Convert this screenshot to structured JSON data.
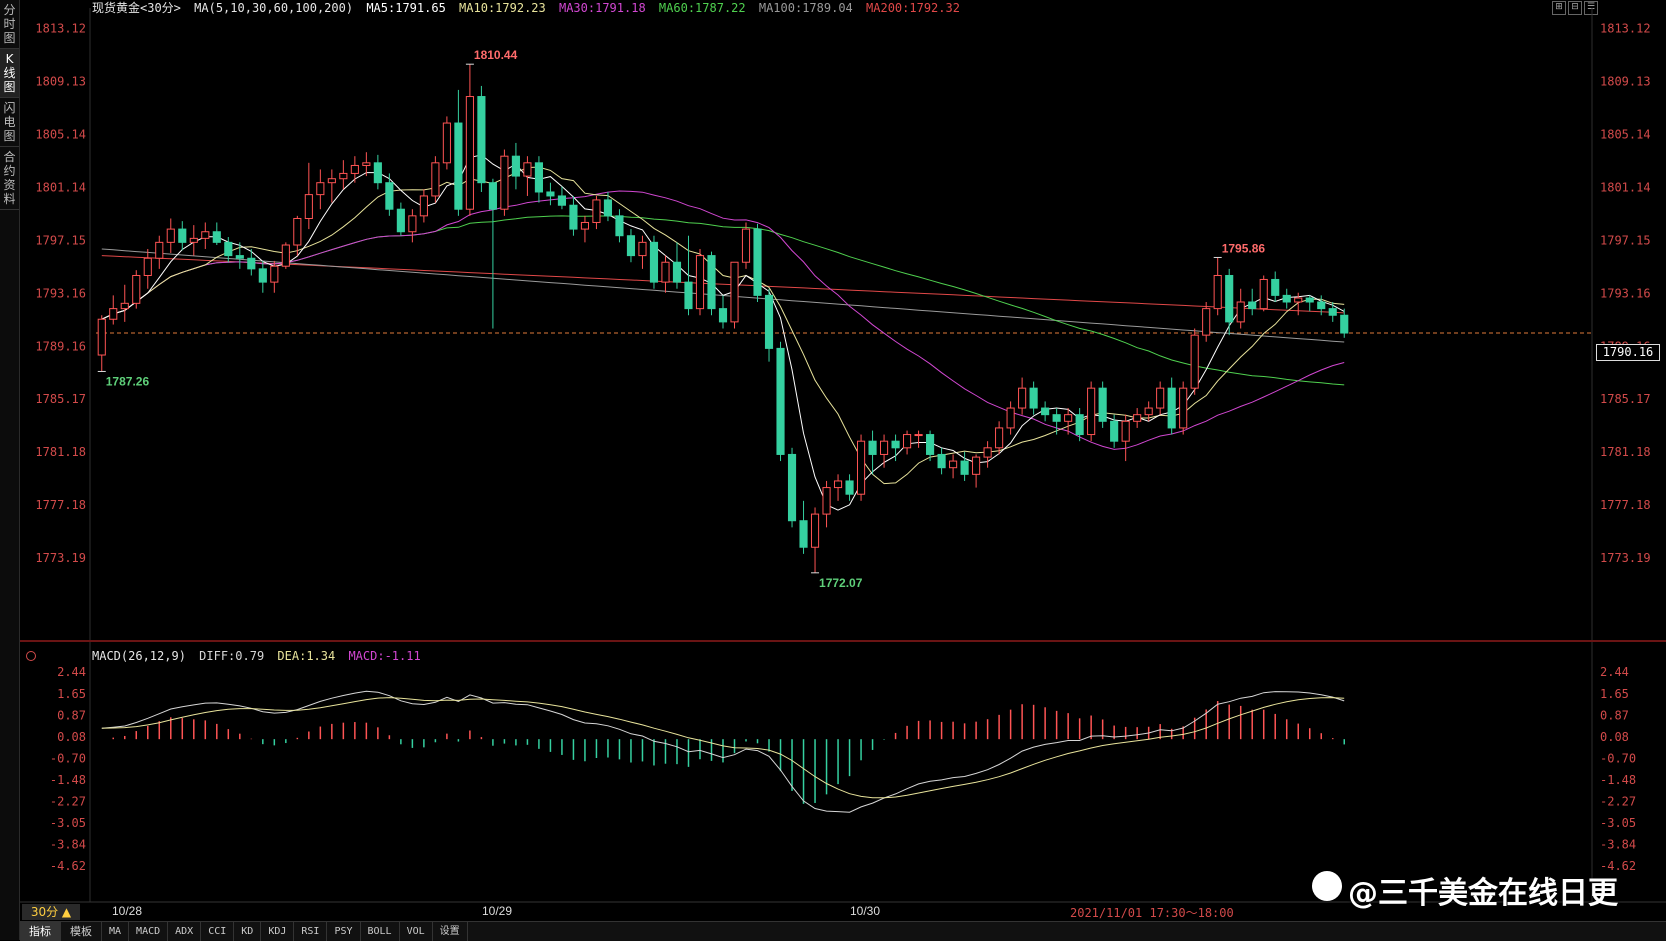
{
  "sidebar": [
    {
      "label": "分时图",
      "active": false
    },
    {
      "label": "K线图",
      "active": true
    },
    {
      "label": "闪电图",
      "active": false
    },
    {
      "label": "合约资料",
      "active": false
    }
  ],
  "header": {
    "symbol": "现货黄金<30分>",
    "ma_params": "MA(5,10,30,60,100,200)",
    "ma5": "MA5:1791.65",
    "ma10": "MA10:1792.23",
    "ma30": "MA30:1791.18",
    "ma60": "MA60:1787.22",
    "ma100": "MA100:1789.04",
    "ma200": "MA200:1792.32"
  },
  "window_buttons": [
    "⊞",
    "⊟",
    "☰"
  ],
  "macd_header": {
    "params": "MACD(26,12,9)",
    "diff": "DIFF:0.79",
    "dea": "DEA:1.34",
    "macd": "MACD:-1.11"
  },
  "price_ticks": [
    "1813.12",
    "1809.13",
    "1805.14",
    "1801.14",
    "1797.15",
    "1793.16",
    "1789.16",
    "1785.17",
    "1781.18",
    "1777.18",
    "1773.19"
  ],
  "right_price_ticks": [
    "1813.12",
    "1809.13",
    "1805.14",
    "1801.14",
    "1797.15",
    "1793.16",
    "1789.16",
    "1785.17",
    "1781.18",
    "1777.18",
    "1773.19"
  ],
  "macd_ticks": [
    "2.44",
    "1.65",
    "0.87",
    "0.08",
    "-0.70",
    "-1.48",
    "-2.27",
    "-3.05",
    "-3.84",
    "-4.62"
  ],
  "current_price": "1790.16",
  "annotations": {
    "high": "1810.44",
    "low": "1772.07",
    "start_low": "1787.26",
    "local_high": "1795.86"
  },
  "dates": [
    "10/28",
    "10/29",
    "10/30"
  ],
  "cursor_time": "2021/11/01  17:30～18:00",
  "period": "30分 ▲",
  "bottom_tabs": [
    "指标",
    "模板",
    "MA",
    "MACD",
    "ADX",
    "CCI",
    "KD",
    "KDJ",
    "RSI",
    "PSY",
    "BOLL",
    "VOL",
    "设置"
  ],
  "watermark": "@三千美金在线日更",
  "colors": {
    "up": "#ff5454",
    "down": "#35d0a0",
    "ma5": "#ffffff",
    "ma10": "#e8e39b",
    "ma30": "#d147d1",
    "ma60": "#4fd04f",
    "ma100": "#9a9a9a",
    "ma200": "#e04848",
    "diff_macd": "#d6d6d6",
    "dea": "#e8e39b",
    "axis": "#d24a4a"
  },
  "chart_data": {
    "type": "candlestick",
    "interval": "30min",
    "price_ylim": [
      1771.0,
      1814.0
    ],
    "macd_ylim": [
      -5.2,
      2.7
    ],
    "candles": [
      [
        1788.5,
        1791.5,
        1787.26,
        1791.2
      ],
      [
        1791.2,
        1793.0,
        1790.8,
        1792.0
      ],
      [
        1792.0,
        1793.8,
        1791.0,
        1792.4
      ],
      [
        1792.4,
        1794.9,
        1792.0,
        1794.5
      ],
      [
        1794.5,
        1796.5,
        1793.5,
        1795.8
      ],
      [
        1795.8,
        1797.5,
        1795.0,
        1797.0
      ],
      [
        1797.0,
        1798.8,
        1796.2,
        1798.0
      ],
      [
        1798.0,
        1798.6,
        1796.4,
        1797.0
      ],
      [
        1797.0,
        1798.3,
        1796.0,
        1797.3
      ],
      [
        1797.3,
        1798.5,
        1796.5,
        1797.8
      ],
      [
        1797.8,
        1798.5,
        1796.8,
        1797.0
      ],
      [
        1797.0,
        1797.4,
        1795.5,
        1796.0
      ],
      [
        1796.0,
        1797.0,
        1795.0,
        1795.8
      ],
      [
        1795.8,
        1796.5,
        1794.5,
        1795.0
      ],
      [
        1795.0,
        1795.6,
        1793.2,
        1794.0
      ],
      [
        1794.0,
        1795.6,
        1793.2,
        1795.2
      ],
      [
        1795.2,
        1797.0,
        1795.0,
        1796.8
      ],
      [
        1796.8,
        1799.0,
        1796.0,
        1798.8
      ],
      [
        1798.8,
        1803.0,
        1798.0,
        1800.6
      ],
      [
        1800.6,
        1802.5,
        1799.5,
        1801.5
      ],
      [
        1801.5,
        1802.5,
        1800.0,
        1801.8
      ],
      [
        1801.8,
        1803.2,
        1801.0,
        1802.2
      ],
      [
        1802.2,
        1803.5,
        1801.5,
        1802.8
      ],
      [
        1802.8,
        1803.8,
        1802.0,
        1803.0
      ],
      [
        1803.0,
        1803.6,
        1801.0,
        1801.5
      ],
      [
        1801.5,
        1802.2,
        1799.0,
        1799.5
      ],
      [
        1799.5,
        1800.0,
        1797.5,
        1797.8
      ],
      [
        1797.8,
        1799.5,
        1797.0,
        1799.0
      ],
      [
        1799.0,
        1801.0,
        1798.5,
        1800.5
      ],
      [
        1800.5,
        1803.5,
        1800.0,
        1803.0
      ],
      [
        1803.0,
        1806.5,
        1802.5,
        1806.0
      ],
      [
        1806.0,
        1808.5,
        1799.0,
        1799.5
      ],
      [
        1799.5,
        1810.44,
        1799.0,
        1808.0
      ],
      [
        1808.0,
        1808.8,
        1800.8,
        1801.5
      ],
      [
        1801.5,
        1801.8,
        1790.5,
        1799.5
      ],
      [
        1799.5,
        1804.0,
        1799.0,
        1803.5
      ],
      [
        1803.5,
        1804.5,
        1801.0,
        1802.0
      ],
      [
        1802.0,
        1803.5,
        1800.5,
        1803.0
      ],
      [
        1803.0,
        1803.5,
        1800.0,
        1800.8
      ],
      [
        1800.8,
        1801.5,
        1799.8,
        1800.5
      ],
      [
        1800.5,
        1801.2,
        1799.5,
        1799.8
      ],
      [
        1799.8,
        1800.5,
        1797.5,
        1798.0
      ],
      [
        1798.0,
        1799.0,
        1797.0,
        1798.5
      ],
      [
        1798.5,
        1800.5,
        1798.0,
        1800.2
      ],
      [
        1800.2,
        1800.8,
        1798.6,
        1799.0
      ],
      [
        1799.0,
        1799.5,
        1797.0,
        1797.5
      ],
      [
        1797.5,
        1798.0,
        1795.5,
        1796.0
      ],
      [
        1796.0,
        1797.5,
        1795.0,
        1797.0
      ],
      [
        1797.0,
        1797.5,
        1793.5,
        1794.0
      ],
      [
        1794.0,
        1796.0,
        1793.2,
        1795.5
      ],
      [
        1795.5,
        1797.0,
        1793.5,
        1794.0
      ],
      [
        1794.0,
        1797.5,
        1791.5,
        1792.0
      ],
      [
        1792.0,
        1796.5,
        1791.5,
        1796.0
      ],
      [
        1796.0,
        1796.3,
        1791.5,
        1792.0
      ],
      [
        1792.0,
        1793.0,
        1790.5,
        1791.0
      ],
      [
        1791.0,
        1795.5,
        1790.5,
        1795.5
      ],
      [
        1795.5,
        1798.5,
        1795.0,
        1798.0
      ],
      [
        1798.0,
        1798.4,
        1792.5,
        1793.0
      ],
      [
        1793.0,
        1793.5,
        1788.0,
        1789.0
      ],
      [
        1789.0,
        1789.5,
        1780.5,
        1781.0
      ],
      [
        1781.0,
        1781.5,
        1775.5,
        1776.0
      ],
      [
        1776.0,
        1777.5,
        1773.5,
        1774.0
      ],
      [
        1774.0,
        1777.0,
        1772.07,
        1776.5
      ],
      [
        1776.5,
        1779.0,
        1775.5,
        1778.5
      ],
      [
        1778.5,
        1779.5,
        1777.5,
        1779.0
      ],
      [
        1779.0,
        1779.5,
        1777.5,
        1778.0
      ],
      [
        1778.0,
        1782.5,
        1777.5,
        1782.0
      ],
      [
        1782.0,
        1782.8,
        1779.5,
        1781.0
      ],
      [
        1781.0,
        1782.5,
        1780.0,
        1782.0
      ],
      [
        1782.0,
        1782.5,
        1780.5,
        1781.5
      ],
      [
        1781.5,
        1782.8,
        1781.0,
        1782.5
      ],
      [
        1782.5,
        1782.8,
        1781.5,
        1782.5
      ],
      [
        1782.5,
        1782.8,
        1780.5,
        1781.0
      ],
      [
        1781.0,
        1781.5,
        1779.5,
        1780.0
      ],
      [
        1780.0,
        1781.0,
        1779.2,
        1780.5
      ],
      [
        1780.5,
        1781.2,
        1779.0,
        1779.5
      ],
      [
        1779.5,
        1781.0,
        1778.5,
        1780.8
      ],
      [
        1780.8,
        1782.0,
        1780.0,
        1781.5
      ],
      [
        1781.5,
        1783.5,
        1781.0,
        1783.0
      ],
      [
        1783.0,
        1785.0,
        1782.5,
        1784.5
      ],
      [
        1784.5,
        1786.8,
        1784.0,
        1786.0
      ],
      [
        1786.0,
        1786.5,
        1784.0,
        1784.5
      ],
      [
        1784.5,
        1785.0,
        1783.5,
        1784.0
      ],
      [
        1784.0,
        1784.5,
        1782.5,
        1783.5
      ],
      [
        1783.5,
        1784.5,
        1782.5,
        1784.0
      ],
      [
        1784.0,
        1784.5,
        1782.0,
        1782.5
      ],
      [
        1782.5,
        1786.5,
        1782.0,
        1786.0
      ],
      [
        1786.0,
        1786.5,
        1783.0,
        1783.5
      ],
      [
        1783.5,
        1784.0,
        1781.5,
        1782.0
      ],
      [
        1782.0,
        1784.0,
        1780.5,
        1783.5
      ],
      [
        1783.5,
        1784.5,
        1783.0,
        1784.0
      ],
      [
        1784.0,
        1785.0,
        1783.5,
        1784.5
      ],
      [
        1784.5,
        1786.5,
        1784.0,
        1786.0
      ],
      [
        1786.0,
        1786.8,
        1782.5,
        1783.0
      ],
      [
        1783.0,
        1786.5,
        1782.5,
        1786.0
      ],
      [
        1786.0,
        1790.5,
        1785.5,
        1790.0
      ],
      [
        1790.0,
        1792.5,
        1789.5,
        1792.0
      ],
      [
        1792.0,
        1795.86,
        1791.5,
        1794.5
      ],
      [
        1794.5,
        1795.0,
        1790.0,
        1791.0
      ],
      [
        1791.0,
        1793.5,
        1790.5,
        1792.5
      ],
      [
        1792.5,
        1793.5,
        1791.5,
        1792.0
      ],
      [
        1792.0,
        1794.5,
        1791.8,
        1794.2
      ],
      [
        1794.2,
        1794.8,
        1792.5,
        1793.0
      ],
      [
        1793.0,
        1793.5,
        1792.0,
        1792.5
      ],
      [
        1792.5,
        1793.2,
        1791.5,
        1792.8
      ],
      [
        1792.8,
        1793.0,
        1791.8,
        1792.5
      ],
      [
        1792.5,
        1793.0,
        1791.5,
        1792.0
      ],
      [
        1792.0,
        1792.5,
        1791.0,
        1791.5
      ],
      [
        1791.5,
        1792.0,
        1789.8,
        1790.16
      ]
    ]
  }
}
